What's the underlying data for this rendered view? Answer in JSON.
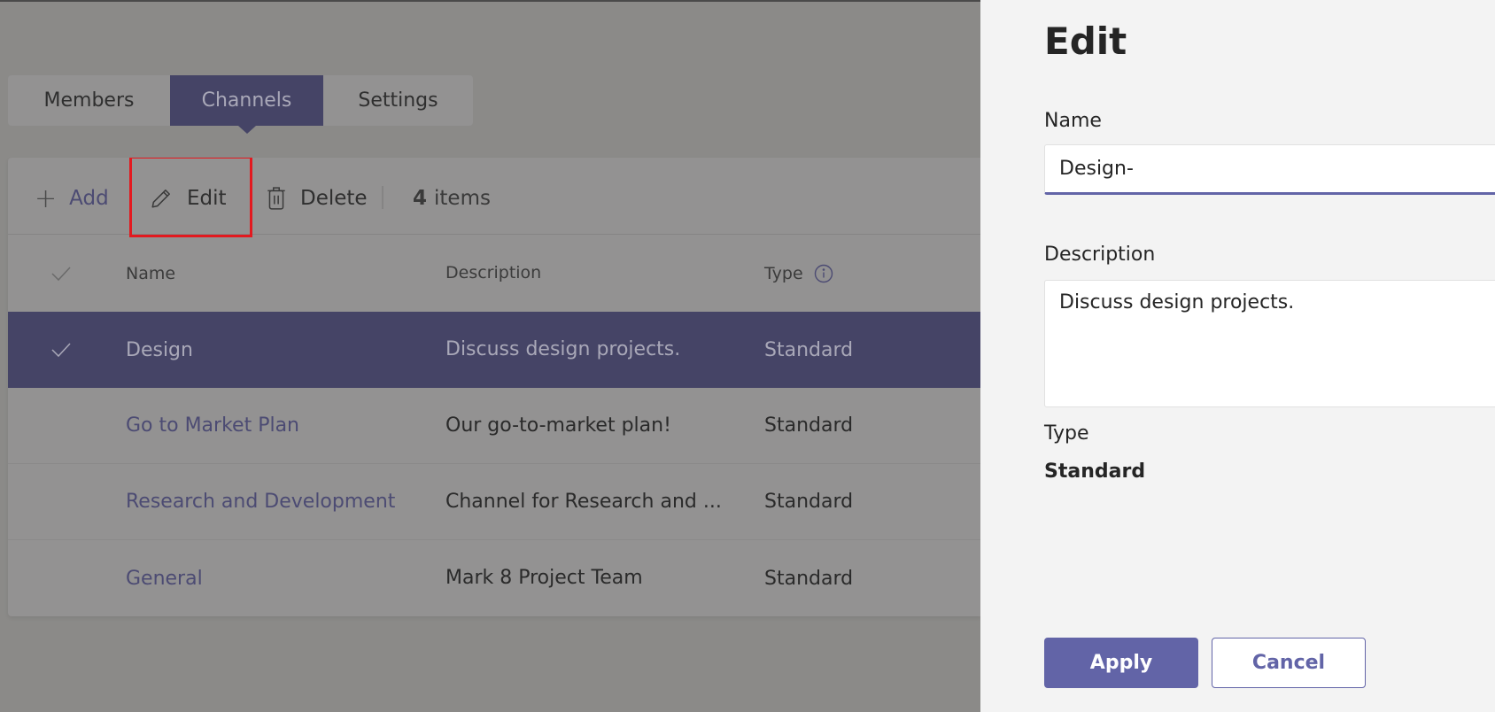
{
  "tabs": [
    {
      "label": "Members",
      "active": false
    },
    {
      "label": "Channels",
      "active": true
    },
    {
      "label": "Settings",
      "active": false
    }
  ],
  "toolbar": {
    "add_label": "Add",
    "edit_label": "Edit",
    "delete_label": "Delete",
    "count_number": "4",
    "count_suffix": "items"
  },
  "table": {
    "columns": [
      "Name",
      "Description",
      "Type"
    ],
    "type_info_icon": "info-icon",
    "rows": [
      {
        "name": "Design",
        "description": "Discuss design projects.",
        "type": "Standard",
        "selected": true
      },
      {
        "name": "Go to Market Plan",
        "description": "Our go-to-market plan!",
        "type": "Standard",
        "selected": false
      },
      {
        "name": "Research and Development",
        "description": "Channel for Research and ...",
        "type": "Standard",
        "selected": false
      },
      {
        "name": "General",
        "description": "Mark 8 Project Team",
        "type": "Standard",
        "selected": false
      }
    ]
  },
  "panel": {
    "title": "Edit",
    "name_label": "Name",
    "name_value": "Design-",
    "description_label": "Description",
    "description_value": "Discuss design projects.",
    "type_label": "Type",
    "type_value": "Standard",
    "apply_label": "Apply",
    "cancel_label": "Cancel"
  },
  "colors": {
    "accent": "#6264a7",
    "selected_row_dimmed": "#454466",
    "highlight_box": "#e3191f",
    "overlay": "#8b8a88",
    "panel_bg": "#f3f3f3"
  }
}
